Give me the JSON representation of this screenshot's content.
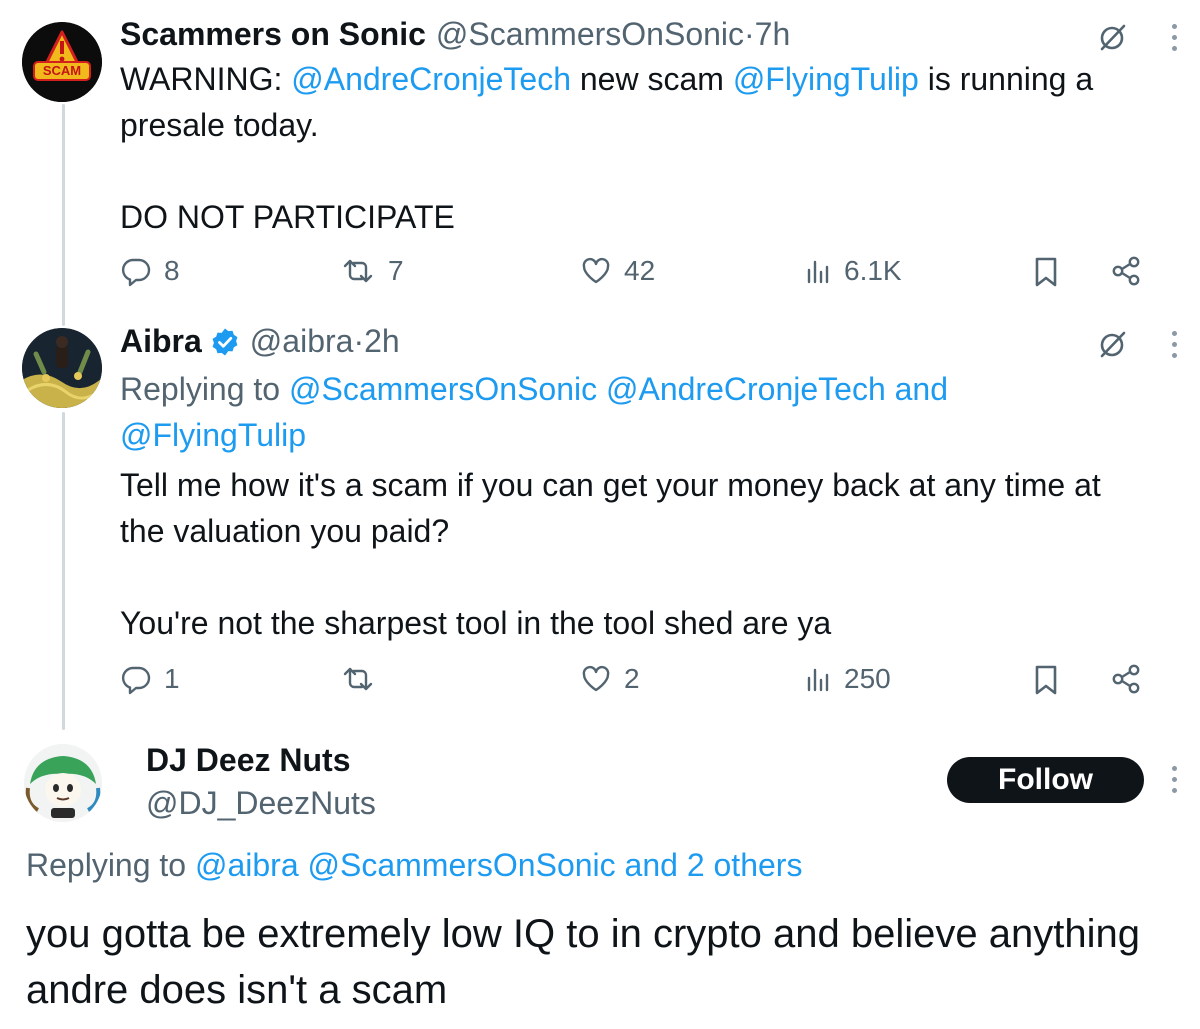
{
  "tweets": [
    {
      "name": "Scammers on Sonic",
      "handle": "@ScammersOnSonic",
      "sep": " · ",
      "time": "7h",
      "avatar_text": "SCAM",
      "text": {
        "p1": "WARNING: ",
        "m1": "@AndreCronjeTech",
        "p2": " new scam ",
        "m2": "@FlyingTulip",
        "p3": " is running a presale today.",
        "p4": "DO NOT PARTICIPATE"
      },
      "stats": {
        "replies": "8",
        "reposts": "7",
        "likes": "42",
        "views": "6.1K"
      }
    },
    {
      "name": "Aibra",
      "handle": "@aibra",
      "sep": " · ",
      "time": "2h",
      "verified": true,
      "reply_prefix": "Replying to ",
      "reply_to": "@ScammersOnSonic @AndreCronjeTech and @FlyingTulip",
      "text": {
        "p1": "Tell me how it's a scam if you can get your money back at any time at the valuation you paid?",
        "p2": "You're not the sharpest tool in the tool shed are ya"
      },
      "stats": {
        "replies": "1",
        "reposts": "",
        "likes": "2",
        "views": "250"
      }
    },
    {
      "name": "DJ Deez Nuts",
      "handle": "@DJ_DeezNuts",
      "follow_label": "Follow",
      "reply_prefix": "Replying to ",
      "reply_to": "@aibra @ScammersOnSonic and 2 others",
      "text": "you gotta be extremely low IQ to in crypto and believe anything andre does isn't a scam"
    }
  ],
  "colors": {
    "mention": "#1d9bf0",
    "secondary": "#536471",
    "verified": "#1d9bf0",
    "thread_line": "#cfd9de",
    "follow_bg": "#0f1419"
  },
  "icons": [
    "reply-icon",
    "repost-icon",
    "like-icon",
    "views-icon",
    "bookmark-icon",
    "share-icon",
    "grok-icon",
    "more-icon",
    "verified-badge-icon"
  ]
}
